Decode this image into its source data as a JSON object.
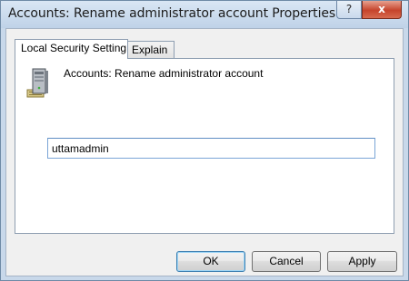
{
  "window": {
    "title": "Accounts: Rename administrator account Properties",
    "help_label": "?",
    "close_label": "x"
  },
  "tabs": [
    {
      "label": "Local Security Setting",
      "active": true
    },
    {
      "label": "Explain",
      "active": false
    }
  ],
  "setting": {
    "policy_name": "Accounts: Rename administrator account",
    "icon": "server-computer-icon",
    "value": "uttamadmin"
  },
  "buttons": {
    "ok_label": "OK",
    "cancel_label": "Cancel",
    "apply_label": "Apply"
  },
  "colors": {
    "frame": "#c8d8ea",
    "close_button": "#c6442c",
    "focus_border": "#3c7fb1"
  }
}
